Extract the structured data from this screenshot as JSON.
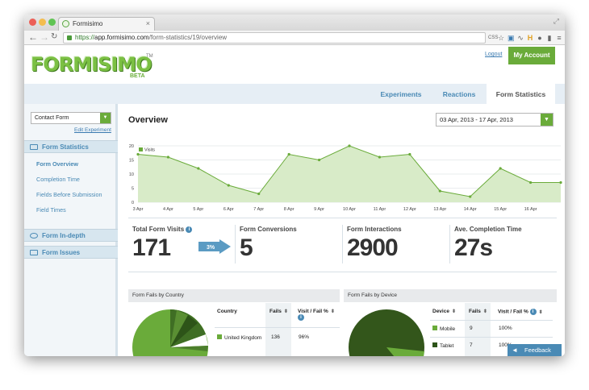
{
  "browser": {
    "tab_title": "Formisimo",
    "tab_close": "×",
    "url_protocol": "https://",
    "url_host": "app.formisimo.com",
    "url_path": "/form-statistics/19/overview",
    "toolbar_icons": [
      "css-icon",
      "star-icon",
      "extension-icon",
      "pulse-icon",
      "h-icon",
      "circle-icon",
      "phone-icon",
      "menu-icon"
    ],
    "css_label": "CSS"
  },
  "header": {
    "logo_text": "FORMISIMO",
    "trademark": "TM",
    "beta": "BETA",
    "logout": "Logout",
    "my_account": "My Account"
  },
  "nav": {
    "tabs": [
      {
        "label": "Experiments"
      },
      {
        "label": "Reactions"
      },
      {
        "label": "Form Statistics"
      }
    ]
  },
  "sidebar": {
    "form_select": "Contact Form",
    "edit_experiment": "Edit Experiment",
    "sections": [
      {
        "label": "Form Statistics"
      },
      {
        "label": "Form In-depth"
      },
      {
        "label": "Form Issues"
      }
    ],
    "items": [
      {
        "label": "Form Overview"
      },
      {
        "label": "Completion Time"
      },
      {
        "label": "Fields Before Submission"
      },
      {
        "label": "Field Times"
      }
    ]
  },
  "main": {
    "title": "Overview",
    "date_range": "03 Apr, 2013 - 17 Apr, 2013"
  },
  "chart_data": {
    "type": "area",
    "legend": [
      "Visits"
    ],
    "x": [
      "3 Apr",
      "4 Apr",
      "5 Apr",
      "6 Apr",
      "7 Apr",
      "8 Apr",
      "9 Apr",
      "10 Apr",
      "11 Apr",
      "12 Apr",
      "13 Apr",
      "14 Apr",
      "15 Apr",
      "16 Apr",
      "17 Apr"
    ],
    "x_ticks": [
      "3 Apr",
      "4 Apr",
      "5 Apr",
      "6 Apr",
      "7 Apr",
      "8 Apr",
      "9 Apr",
      "10 Apr",
      "11 Apr",
      "12 Apr",
      "13 Apr",
      "14 Apr",
      "15 Apr",
      "16 Apr"
    ],
    "series": [
      {
        "name": "Visits",
        "values": [
          17,
          16,
          12,
          6,
          3,
          17,
          15,
          20,
          16,
          17,
          4,
          2,
          12,
          7,
          7
        ]
      }
    ],
    "ylim": [
      0,
      20
    ],
    "y_ticks": [
      0,
      5,
      10,
      15,
      20
    ],
    "grid": true,
    "legend_position": "top-left",
    "color": "#6aab3a"
  },
  "stats": {
    "visits_label": "Total Form Visits",
    "visits_value": "171",
    "conversion_rate": "3%",
    "conversions_label": "Form Conversions",
    "conversions_value": "5",
    "interactions_label": "Form Interactions",
    "interactions_value": "2900",
    "completion_label": "Ave. Completion Time",
    "completion_value": "27s"
  },
  "country_panel": {
    "title": "Form Fails by Country",
    "col_country": "Country",
    "col_fails": "Fails",
    "col_ratio": "Visit / Fail %",
    "rows": [
      {
        "country": "United Kingdom",
        "fails": "136",
        "ratio": "96%"
      }
    ]
  },
  "device_panel": {
    "title": "Form Fails by Device",
    "col_device": "Device",
    "col_fails": "Fails",
    "col_ratio": "Visit / Fail %",
    "rows": [
      {
        "device": "Mobile",
        "fails": "9",
        "ratio": "100%"
      },
      {
        "device": "Tablet",
        "fails": "7",
        "ratio": "100%"
      }
    ]
  },
  "feedback": "Feedback",
  "info_glyph": "i",
  "sort_glyph": "⬍",
  "dropdown_glyph": "▼",
  "colors": {
    "accent": "#6aab3a",
    "link": "#4a8ab5",
    "arrow": "#5b9bc3"
  }
}
